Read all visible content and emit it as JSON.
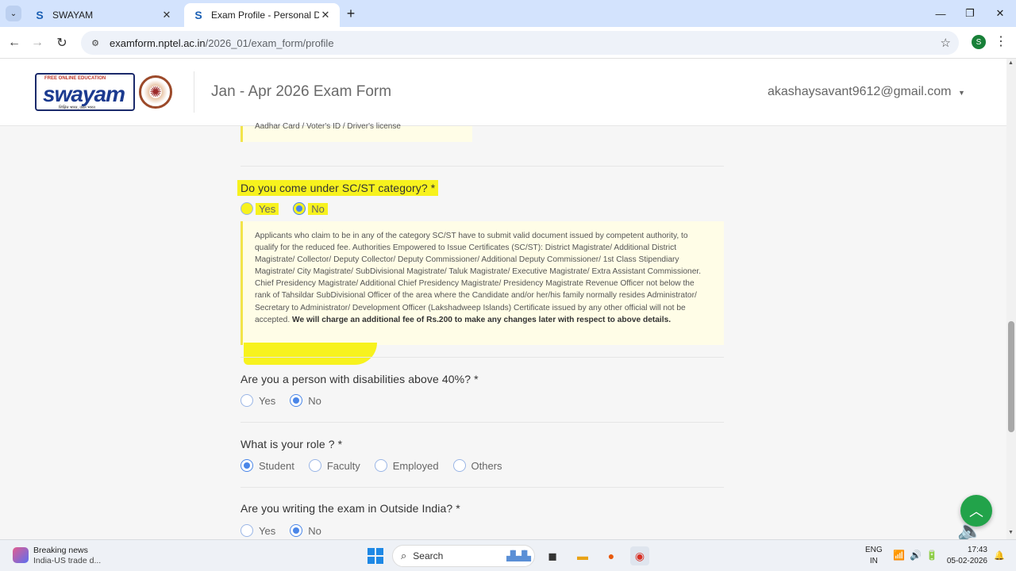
{
  "browser": {
    "tabs": [
      {
        "label": "SWAYAM",
        "favicon": "S",
        "active": false
      },
      {
        "label": "Exam Profile - Personal Details",
        "favicon": "S",
        "active": true
      }
    ],
    "url_host": "examform.nptel.ac.in",
    "url_path": "/2026_01/exam_form/profile",
    "profile_initial": "S"
  },
  "header": {
    "logo_tag": "FREE ONLINE EDUCATION",
    "logo_word": "swayam",
    "logo_hindi": "शिक्षित भारत, उन्नत भारत",
    "title": "Jan - Apr 2026 Exam Form",
    "user_email": "akashaysavant9612@gmail.com"
  },
  "form": {
    "top_note": "Aadhar Card / Voter's ID / Driver's license",
    "q_scst": {
      "label": "Do you come under SC/ST category? *",
      "options": [
        "Yes",
        "No"
      ],
      "selected": "No",
      "info_text": "Applicants who claim to be in any of the category SC/ST have to submit valid document issued by competent authority, to qualify for the reduced fee. Authorities Empowered to Issue Certificates (SC/ST): District Magistrate/ Additional District Magistrate/ Collector/ Deputy Collector/ Deputy Commissioner/ Additional Deputy Commissioner/ 1st Class Stipendiary Magistrate/ City Magistrate/ SubDivisional Magistrate/ Taluk Magistrate/ Executive Magistrate/ Extra Assistant Commissioner. Chief Presidency Magistrate/ Additional Chief Presidency Magistrate/ Presidency Magistrate Revenue Officer not below the rank of Tahsildar SubDivisional Officer of the area where the Candidate and/or her/his family normally resides Administrator/ Secretary to Administrator/ Development Officer (Lakshadweep Islands) Certificate issued by any other official will not be accepted.",
      "info_bold": "We will charge an additional fee of Rs.200 to make any changes later with respect to above details."
    },
    "q_disability": {
      "label": "Are you a person with disabilities above 40%? *",
      "options": [
        "Yes",
        "No"
      ],
      "selected": "No"
    },
    "q_role": {
      "label": "What is your role ? *",
      "options": [
        "Student",
        "Faculty",
        "Employed",
        "Others"
      ],
      "selected": "Student"
    },
    "q_outside": {
      "label": "Are you writing the exam in Outside India? *",
      "options": [
        "Yes",
        "No"
      ],
      "selected": "No"
    }
  },
  "taskbar": {
    "news_title": "Breaking news",
    "news_sub": "India-US trade d...",
    "search_placeholder": "Search",
    "lang_1": "ENG",
    "lang_2": "IN",
    "time": "17:43",
    "date": "05-02-2026"
  },
  "colors": {
    "highlight": "#f7f21e",
    "radio_accent": "#4a86e8",
    "info_bg": "#fffde7",
    "fab": "#22a34a"
  }
}
